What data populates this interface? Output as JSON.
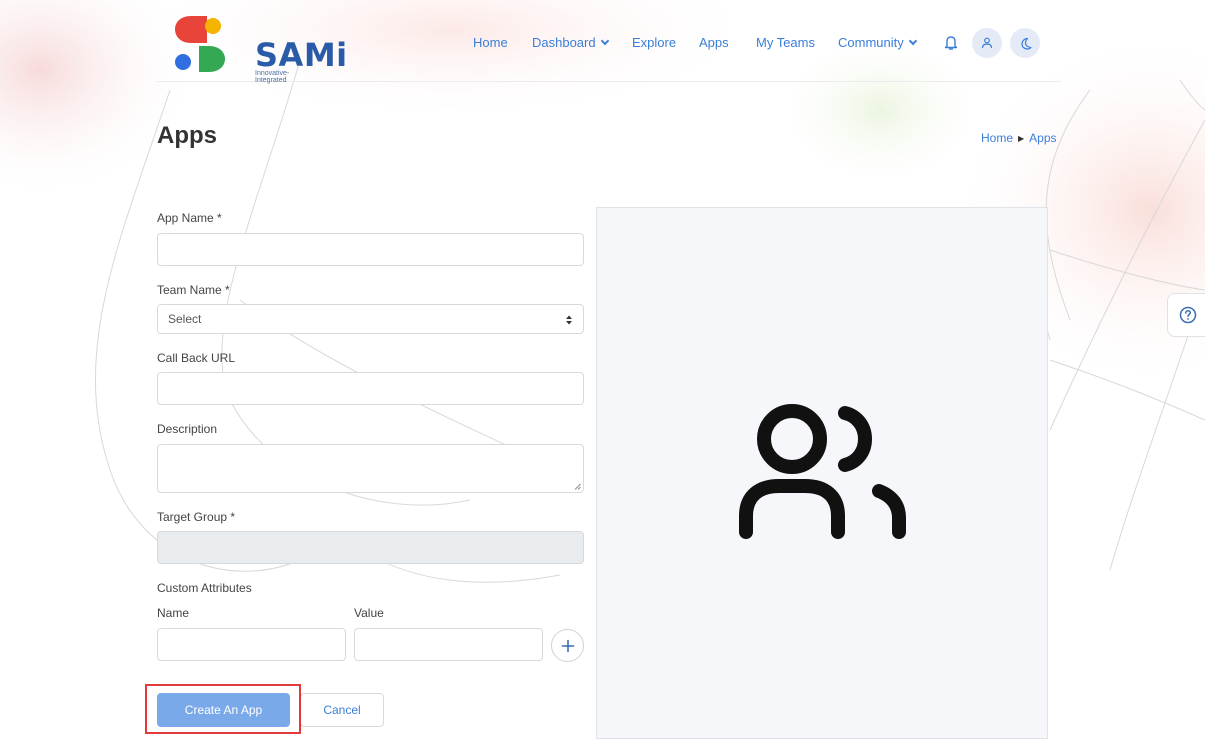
{
  "brand": {
    "name": "SAMi",
    "tagline": "Innovative-Integrated",
    "colors": {
      "red": "#e8443a",
      "yellow": "#f4b400",
      "blue": "#2f6fe0",
      "green": "#34a853"
    }
  },
  "nav": {
    "items": [
      {
        "label": "Home"
      },
      {
        "label": "Dashboard",
        "dropdown": true
      },
      {
        "label": "Explore"
      },
      {
        "label": "Apps"
      },
      {
        "label": "My Teams"
      },
      {
        "label": "Community",
        "dropdown": true
      }
    ],
    "icons": [
      "bell-icon",
      "user-icon",
      "moon-icon"
    ],
    "link_color": "#3b7ed8"
  },
  "page": {
    "title": "Apps",
    "breadcrumb": {
      "home": "Home",
      "current": "Apps"
    }
  },
  "form": {
    "app_name": {
      "label": "App Name",
      "required_mark": "*",
      "value": ""
    },
    "team_name": {
      "label": "Team Name",
      "required_mark": "*",
      "selected": "Select"
    },
    "callback_url": {
      "label": "Call Back URL",
      "value": ""
    },
    "description": {
      "label": "Description",
      "value": ""
    },
    "target_group": {
      "label": "Target Group",
      "required_mark": "*",
      "value": ""
    },
    "custom_attributes": {
      "label": "Custom Attributes",
      "name_label": "Name",
      "value_label": "Value",
      "add_icon": "plus-icon"
    },
    "buttons": {
      "create": "Create An App",
      "cancel": "Cancel"
    },
    "create_button_color": "#7aa9ea",
    "highlight_color": "#e03a3a"
  },
  "preview": {
    "icon": "users-icon",
    "background": "#f5f7fa"
  },
  "help": {
    "icon": "question-circle-icon"
  }
}
